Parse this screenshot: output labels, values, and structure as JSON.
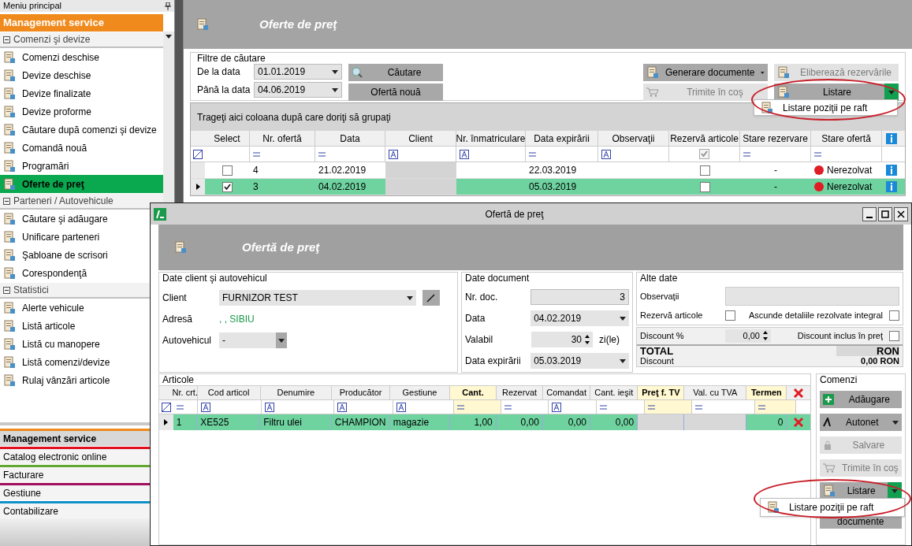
{
  "sidebar": {
    "title": "Meniu principal",
    "module": "Management service",
    "groups": [
      {
        "label": "Comenzi şi devize",
        "expanded": true,
        "items": [
          {
            "label": "Comenzi deschise",
            "selected": false
          },
          {
            "label": "Devize deschise",
            "selected": false
          },
          {
            "label": "Devize finalizate",
            "selected": false
          },
          {
            "label": "Devize proforme",
            "selected": false
          },
          {
            "label": "Căutare după comenzi şi devize",
            "selected": false
          },
          {
            "label": "Comandă nouă",
            "selected": false
          },
          {
            "label": "Programări",
            "selected": false
          },
          {
            "label": "Oferte de preţ",
            "selected": true
          }
        ]
      },
      {
        "label": "Parteneri / Autovehicule",
        "expanded": true,
        "items": [
          {
            "label": "Căutare şi adăugare",
            "selected": false
          },
          {
            "label": "Unificare parteneri",
            "selected": false
          },
          {
            "label": "Şabloane de scrisori",
            "selected": false
          },
          {
            "label": "Corespondenţă",
            "selected": false
          }
        ]
      },
      {
        "label": "Statistici",
        "expanded": true,
        "items": [
          {
            "label": "Alerte vehicule",
            "selected": false
          },
          {
            "label": "Listă articole",
            "selected": false
          },
          {
            "label": "Listă cu manopere",
            "selected": false
          },
          {
            "label": "Listă comenzi/devize",
            "selected": false
          },
          {
            "label": "Rulaj vânzări articole",
            "selected": false
          }
        ]
      }
    ]
  },
  "modules": [
    {
      "label": "Management service",
      "color": "#f08a1c",
      "selected": true
    },
    {
      "label": "Catalog electronic online",
      "color": "#e0101e",
      "selected": false
    },
    {
      "label": "Facturare",
      "color": "#62a830",
      "selected": false
    },
    {
      "label": "Gestiune",
      "color": "#a0105e",
      "selected": false
    },
    {
      "label": "Contabilizare",
      "color": "#1090c8",
      "selected": false
    }
  ],
  "main": {
    "title": "Oferte de preţ",
    "filters": {
      "label": "Filtre de căutare",
      "from_label": "De la data",
      "from_value": "01.01.2019",
      "to_label": "Până la data",
      "to_value": "04.06.2019"
    },
    "buttons": [
      {
        "label": "Căutare",
        "disabled": false
      },
      {
        "label": "Generare documente",
        "disabled": false
      },
      {
        "label": "Eliberează rezervările",
        "disabled": true
      },
      {
        "label": "Ofertă nouă",
        "disabled": false
      },
      {
        "label": "Trimite în coş",
        "disabled": true
      },
      {
        "label": "Listare",
        "disabled": false
      }
    ],
    "menu_item": "Listare poziţii pe raft",
    "group_hint": "Trageţi aici coloana după care doriţi să grupaţi",
    "columns": [
      "Select",
      "Nr. ofertă",
      "Data",
      "Client",
      "Nr. înmatriculare",
      "Data expirării",
      "Observaţii",
      "Rezervă articole",
      "Stare rezervare",
      "Stare ofertă"
    ],
    "reserve_filter": true,
    "rows": [
      {
        "selected": false,
        "checked": false,
        "number": "4",
        "date": "21.02.2019",
        "expiry": "22.03.2019",
        "reserve": false,
        "reservation": {
          "label": "-"
        },
        "status": {
          "label": "Nerezolvat",
          "color": "#e01c24"
        }
      },
      {
        "selected": true,
        "checked": true,
        "number": "3",
        "date": "04.02.2019",
        "expiry": "05.03.2019",
        "reserve": false,
        "reservation": {
          "label": "-"
        },
        "status": {
          "label": "Nerezolvat",
          "color": "#e01c24"
        }
      }
    ]
  },
  "dialog": {
    "title": "Ofertă de preţ",
    "header": "Ofertă de preţ",
    "client_group": {
      "label": "Date client şi autovehicul",
      "client_label": "Client",
      "client": "FURNIZOR TEST",
      "address_label": "Adresă",
      "address": ", , SIBIU",
      "vehicle_label": "Autovehicul",
      "vehicle": "-"
    },
    "document_group": {
      "label": "Date document",
      "number_label": "Nr. doc.",
      "number": "3",
      "date_label": "Data",
      "date": "04.02.2019",
      "valid_label": "Valabil",
      "valid": "30",
      "valid_unit": "zi(le)",
      "expiry_label": "Data expirării",
      "expiry": "05.03.2019"
    },
    "other_group": {
      "label": "Alte date",
      "notes_label": "Observaţii",
      "reserve_label": "Rezervă articole",
      "reserve": false,
      "hide_label": "Ascunde detaliile rezolvate integral",
      "hide": false,
      "discount_label": "Discount %",
      "discount": "0,00",
      "included_label": "Discount inclus în preţ",
      "included": false,
      "total_label": "TOTAL",
      "total_currency": "RON",
      "discount_total_label": "Discount",
      "discount_total": "0,00 RON"
    },
    "articles": {
      "label": "Articole",
      "columns": [
        {
          "label": "Nr. crt.",
          "highlight": false
        },
        {
          "label": "Cod articol",
          "highlight": false
        },
        {
          "label": "Denumire",
          "highlight": false
        },
        {
          "label": "Producător",
          "highlight": false
        },
        {
          "label": "Gestiune",
          "highlight": false
        },
        {
          "label": "Cant.",
          "highlight": true
        },
        {
          "label": "Rezervat",
          "highlight": false
        },
        {
          "label": "Comandat",
          "highlight": false
        },
        {
          "label": "Cant. ieşit",
          "highlight": false
        },
        {
          "label": "Preţ f. TV",
          "highlight": true
        },
        {
          "label": "Val. cu TVA",
          "highlight": false
        },
        {
          "label": "Termen",
          "highlight": true
        }
      ],
      "rows": [
        {
          "selected": true,
          "cells": [
            "1",
            "XE525",
            "Filtru ulei",
            "CHAMPION",
            "magazie",
            "1,00",
            "0,00",
            "0,00",
            "0,00",
            "",
            "",
            "0"
          ]
        }
      ]
    },
    "commands": {
      "label": "Comenzi",
      "buttons": [
        {
          "label": "Adăugare",
          "disabled": false,
          "kind": "add"
        },
        {
          "label": "Autonet",
          "disabled": false,
          "kind": "dropdown"
        },
        {
          "label": "Salvare",
          "disabled": true,
          "kind": "save"
        },
        {
          "label": "Trimite în coş",
          "disabled": true,
          "kind": "cart"
        },
        {
          "label": "Listare",
          "disabled": false,
          "kind": "split"
        }
      ],
      "menu_item": "Listare poziţii pe raft",
      "hidden_button": "documente"
    }
  }
}
